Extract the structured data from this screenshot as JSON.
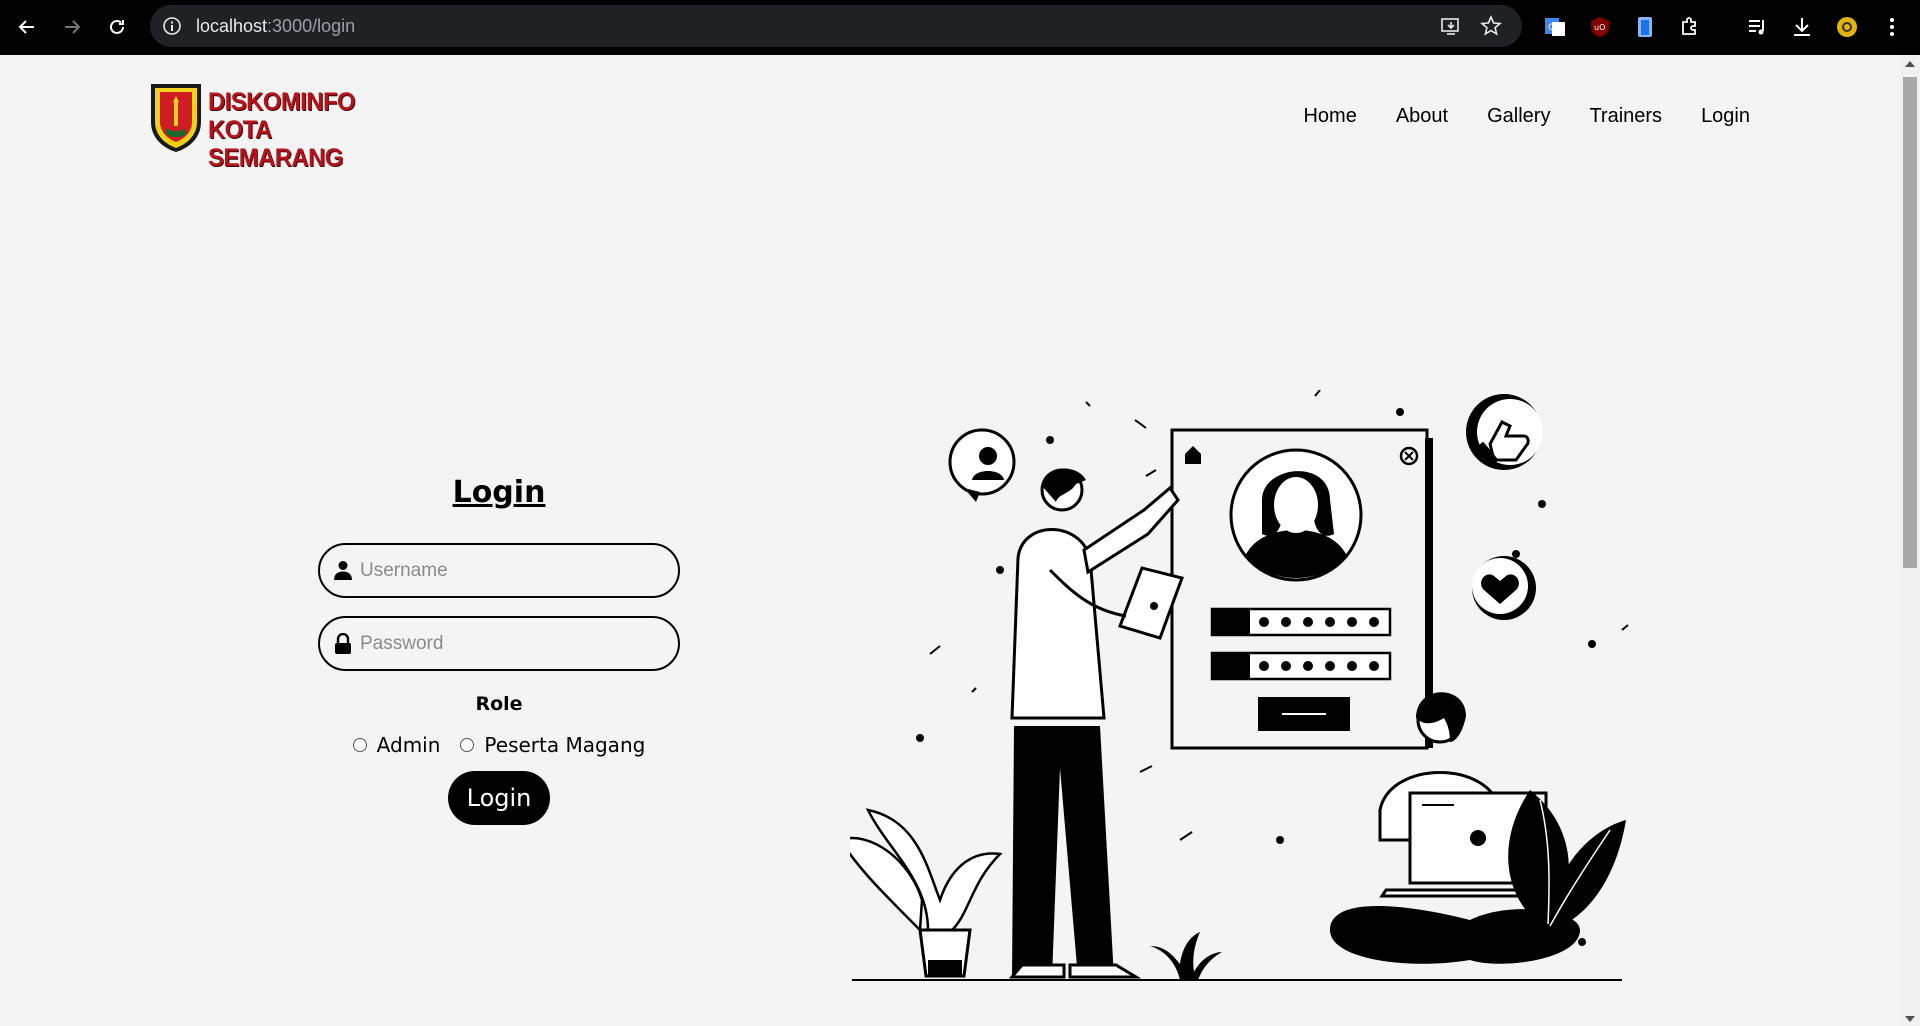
{
  "browser": {
    "url_host": "localhost",
    "url_path": ":3000/login"
  },
  "site": {
    "logo_line1": "DISKOMINFO",
    "logo_line2": "KOTA SEMARANG",
    "nav": [
      "Home",
      "About",
      "Gallery",
      "Trainers",
      "Login"
    ]
  },
  "login": {
    "title": "Login",
    "username_placeholder": "Username",
    "password_placeholder": "Password",
    "role_label": "Role",
    "roles": [
      "Admin",
      "Peserta Magang"
    ],
    "button": "Login"
  },
  "colors": {
    "logo_red": "#b3141c",
    "button_bg": "#000000",
    "page_bg": "#f4f4f4"
  }
}
